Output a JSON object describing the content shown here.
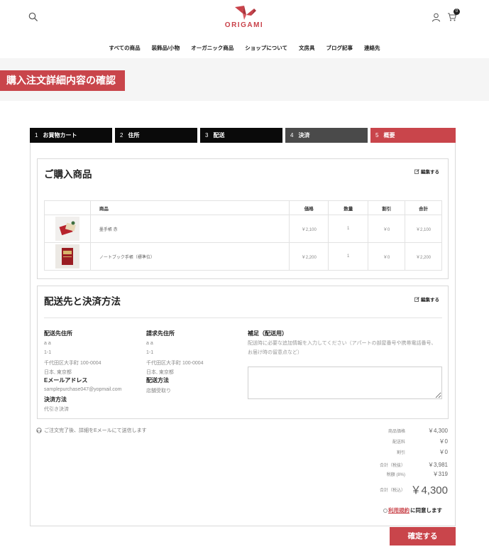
{
  "header": {
    "brand": "ORIGAMI",
    "cart_count": "0",
    "icons": {
      "search": "search-icon",
      "logo": "origami-crane-logo",
      "user": "user-icon",
      "cart": "cart-icon"
    }
  },
  "nav": {
    "items": [
      {
        "label": "すべての商品"
      },
      {
        "label": "装飾品/小物"
      },
      {
        "label": "オーガニック商品"
      },
      {
        "label": "ショップについて"
      },
      {
        "label": "文房具"
      },
      {
        "label": "ブログ記事"
      },
      {
        "label": "連絡先"
      }
    ]
  },
  "page": {
    "title": "購入注文詳細内容の確認"
  },
  "steps": [
    {
      "num": "1",
      "label": "お買物カート",
      "state": "done"
    },
    {
      "num": "2",
      "label": "住所",
      "state": "done"
    },
    {
      "num": "3",
      "label": "配送",
      "state": "done"
    },
    {
      "num": "4",
      "label": "決済",
      "state": "current"
    },
    {
      "num": "5",
      "label": "概要",
      "state": "active"
    }
  ],
  "items_panel": {
    "title": "ご購入商品",
    "edit_label": "編集する",
    "columns": {
      "product": "商品",
      "price": "価格",
      "qty": "数量",
      "discount": "割引",
      "total": "合計"
    },
    "rows": [
      {
        "name": "墨手帳 赤",
        "price": "￥2,100",
        "qty": "1",
        "discount": "￥0",
        "total": "￥2,100"
      },
      {
        "name": "ノートブック手帳（標準位）",
        "price": "￥2,200",
        "qty": "1",
        "discount": "￥0",
        "total": "￥2,200"
      }
    ]
  },
  "shipping_panel": {
    "title": "配送先と決済方法",
    "edit_label": "編集する",
    "ship_to": {
      "label": "配送先住所",
      "name": "a a",
      "line1": "1-1",
      "line2": "千代田区大手町 100-0004",
      "line3": "日本, 東京都"
    },
    "email": {
      "label": "Eメールアドレス",
      "value": "samplepurchase047@yopmail.com"
    },
    "payment": {
      "label": "決済方法",
      "value": "代引き決済"
    },
    "bill_to": {
      "label": "請求先住所",
      "name": "a a",
      "line1": "1-1",
      "line2": "千代田区大手町 100-0004",
      "line3": "日本, 東京都"
    },
    "delivery": {
      "label": "配送方法",
      "value": "店舗受取り"
    },
    "note": {
      "label": "補足（配送用）",
      "text": "配送時に必要な追加情報を入力してください（アパートの部屋番号や携帯電話番号、お届け時の留意点など）",
      "value": ""
    }
  },
  "notice": {
    "text": "ご注文完了後、詳細をEメールにて送信します"
  },
  "summary": {
    "subtotal_label": "商品価格",
    "subtotal": "￥4,300",
    "shipping_label": "配送料",
    "shipping": "￥0",
    "discount_label": "割引",
    "discount": "￥0",
    "net_label": "合計（税抜）",
    "net": "￥3,981",
    "tax_label": "税額 (8%)",
    "tax": "￥319",
    "total_label": "合計（税込）",
    "total": "￥4,300"
  },
  "agreement": {
    "link": "利用規約",
    "suffix": "に同意します"
  },
  "confirm_button": {
    "label": "確定する"
  },
  "colors": {
    "accent": "#c9454b",
    "step_done": "#0a0a0a",
    "step_current": "#4a4a4a",
    "banner": "#f5f5f5"
  }
}
